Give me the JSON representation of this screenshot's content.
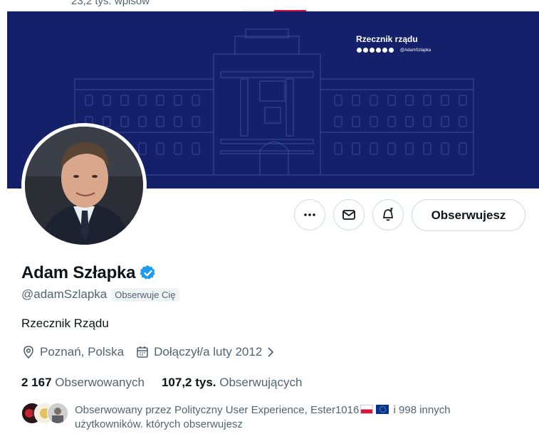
{
  "header": {
    "post_count": "23,2 tys. wpisów"
  },
  "banner": {
    "title": "Rzecznik rządu",
    "handle": "@AdamSzlapka",
    "colors": {
      "background": "#14206a",
      "lines": "#3d4c9a"
    }
  },
  "actions": {
    "more_icon": "more-horizontal-icon",
    "message_icon": "envelope-icon",
    "notify_icon": "bell-icon",
    "follow_label": "Obserwujesz"
  },
  "profile": {
    "name": "Adam Szłapka",
    "verified_icon": "verified-badge-icon",
    "verified_color": "#1d9bf0",
    "handle": "@adamSzlapka",
    "follows_you": "Obserwuje Cię",
    "bio": "Rzecznik Rządu",
    "location": "Poznań, Polska",
    "joined": "Dołączył/a luty 2012"
  },
  "stats": {
    "following_count": "2 167",
    "following_label": "Obserwowanych",
    "followers_count": "107,2 tys.",
    "followers_label": "Obserwujących"
  },
  "followed_by": {
    "prefix": "Obserwowany przez Polityczny User Experience, Ester1016",
    "suffix": "i 998 innych użytkowników. których obserwujesz"
  }
}
